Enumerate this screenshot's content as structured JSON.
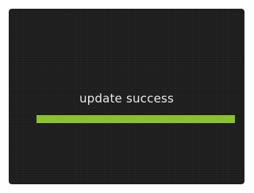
{
  "status": {
    "message": "update success"
  },
  "progress": {
    "value_percent": 100,
    "color": "#8cc22d"
  },
  "colors": {
    "screen_background": "#1c1c1c",
    "text": "#e8e8e8"
  }
}
